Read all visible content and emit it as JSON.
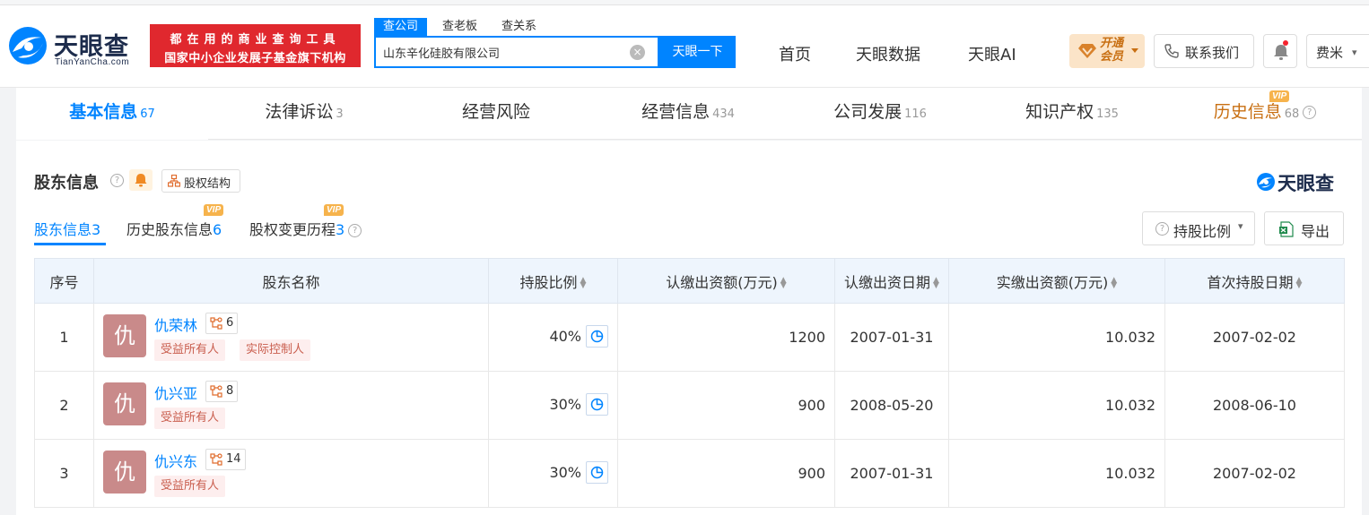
{
  "brand": {
    "name": "天眼查",
    "domain": "TianYanCha.com",
    "accent": "#0084ff"
  },
  "slogan": {
    "line1": "都在用的商业查询工具",
    "line2": "国家中小企业发展子基金旗下机构"
  },
  "search": {
    "tabs": [
      "查公司",
      "查老板",
      "查关系"
    ],
    "value": "山东辛化硅胶有限公司",
    "button": "天眼一下"
  },
  "nav": {
    "home": "首页",
    "data": "天眼数据",
    "ai": "天眼AI"
  },
  "vip_button": {
    "line1": "开通",
    "line2": "会员"
  },
  "contact": "联系我们",
  "user": "费米",
  "main_tabs": [
    {
      "label": "基本信息",
      "count": "67"
    },
    {
      "label": "法律诉讼",
      "count": "3"
    },
    {
      "label": "经营风险",
      "count": ""
    },
    {
      "label": "经营信息",
      "count": "434"
    },
    {
      "label": "公司发展",
      "count": "116"
    },
    {
      "label": "知识产权",
      "count": "135"
    },
    {
      "label": "历史信息",
      "count": "68"
    }
  ],
  "vip_tag": "VIP",
  "section": {
    "title": "股东信息",
    "structure": "股权结构",
    "logo": "天眼查",
    "subtabs": [
      {
        "label": "股东信息",
        "count": "3"
      },
      {
        "label": "历史股东信息",
        "count": "6"
      },
      {
        "label": "股权变更历程",
        "count": "3"
      }
    ],
    "ratio_button": "持股比例",
    "export_button": "导出"
  },
  "table": {
    "headers": [
      "序号",
      "股东名称",
      "持股比例",
      "认缴出资额(万元)",
      "认缴出资日期",
      "实缴出资额(万元)",
      "首次持股日期"
    ],
    "rows": [
      {
        "idx": "1",
        "avatar": "仇",
        "name": "仇荣林",
        "relations": "6",
        "tags": [
          "受益所有人",
          "实际控制人"
        ],
        "ratio": "40%",
        "subscribed": "1200",
        "sub_date": "2007-01-31",
        "paid": "10.032",
        "first_date": "2007-02-02"
      },
      {
        "idx": "2",
        "avatar": "仇",
        "name": "仇兴亚",
        "relations": "8",
        "tags": [
          "受益所有人"
        ],
        "ratio": "30%",
        "subscribed": "900",
        "sub_date": "2008-05-20",
        "paid": "10.032",
        "first_date": "2008-06-10"
      },
      {
        "idx": "3",
        "avatar": "仇",
        "name": "仇兴东",
        "relations": "14",
        "tags": [
          "受益所有人"
        ],
        "ratio": "30%",
        "subscribed": "900",
        "sub_date": "2007-01-31",
        "paid": "10.032",
        "first_date": "2007-02-02"
      }
    ]
  }
}
